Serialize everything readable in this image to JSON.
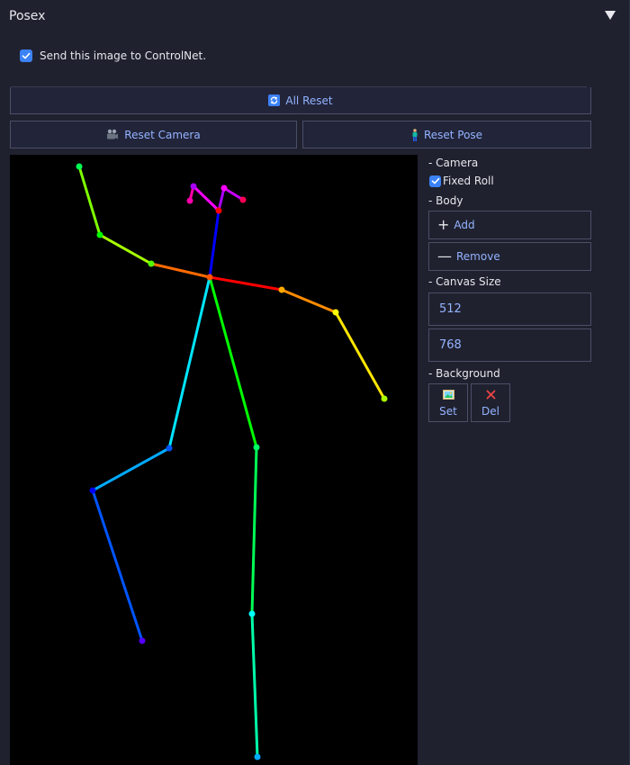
{
  "header": {
    "title": "Posex"
  },
  "send": {
    "label": "Send this image to ControlNet.",
    "checked": true
  },
  "buttons": {
    "all_reset": "All Reset",
    "reset_camera": "Reset Camera",
    "reset_pose": "Reset Pose"
  },
  "sidebar": {
    "camera_heading": "- Camera",
    "fixed_roll": "Fixed Roll",
    "body_heading": "- Body",
    "add": "Add",
    "remove": "Remove",
    "canvas_size_heading": "- Canvas Size",
    "width": "512",
    "height": "768",
    "background_heading": "- Background",
    "set": "Set",
    "del": "Del"
  },
  "colors": {
    "accent": "#3b82f6",
    "button_text": "#93b4ff",
    "panel_bg": "#20212f",
    "border": "#4b4f66"
  }
}
